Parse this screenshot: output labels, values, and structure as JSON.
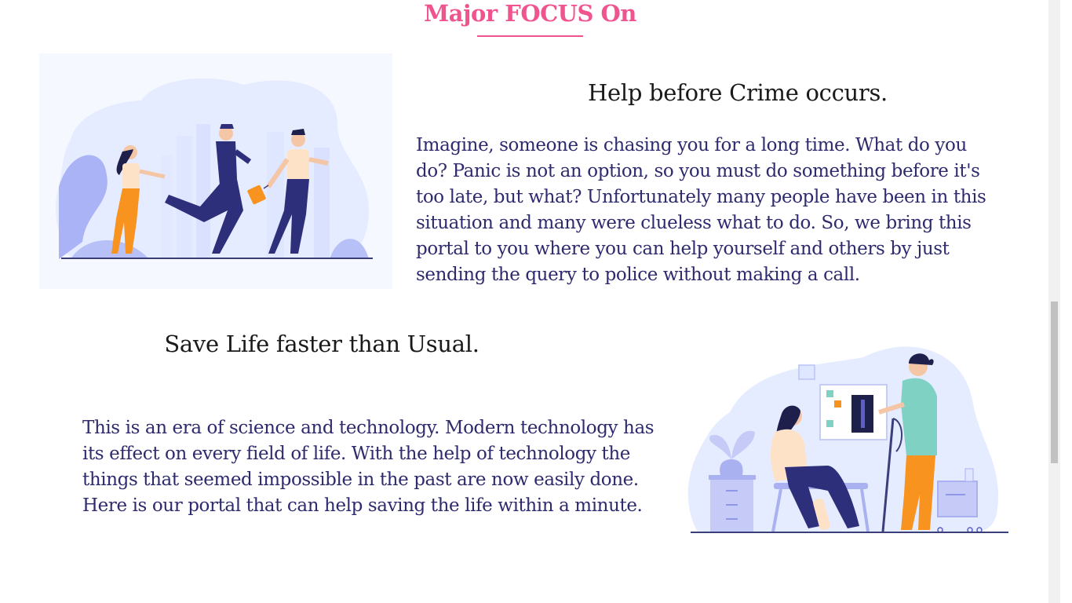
{
  "section": {
    "title": "Major FOCUS On"
  },
  "colors": {
    "accent": "#f0548f",
    "body_text": "#2e2a6e",
    "heading_text": "#1a1a1a",
    "illustration_blue": "#5b5fc7",
    "illustration_light": "#dfe6ff",
    "illustration_orange": "#f7931e"
  },
  "blocks": [
    {
      "heading": "Help before Crime occurs.",
      "text": "Imagine, someone is chasing you for a long time. What do you do? Panic is not an option, so you must do something before it's too late, but what? Unfortunately many people have been in this situation and many were clueless what to do. So, we bring this portal to you where you can help yourself and others by just sending the query to police without making a call.",
      "illustration": "police-chase-illustration"
    },
    {
      "heading": "Save Life faster than Usual.",
      "text": "This is an era of science and technology. Modern technology has its effect on every field of life. With the help of technology the things that seemed impossible in the past are now easily done. Here is our portal that can help saving the life within a minute.",
      "illustration": "doctor-patient-illustration"
    }
  ]
}
